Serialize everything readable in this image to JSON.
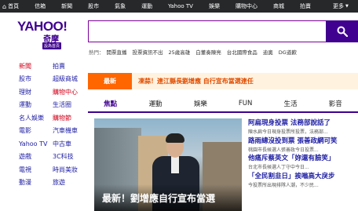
{
  "topnav": {
    "items": [
      "首頁",
      "信箱",
      "新聞",
      "股市",
      "氣象",
      "運動",
      "Yahoo TV",
      "娛樂",
      "購物中心",
      "商城",
      "拍賣",
      "更多"
    ]
  },
  "logo": {
    "brand": "YAHOO!",
    "sub": "奇摩",
    "tag": "設為首頁"
  },
  "search": {
    "placeholder": "",
    "button_icon": "search-icon"
  },
  "trending": {
    "label": "熱門：",
    "items": [
      "開票直播",
      "投票資訊不出",
      "25歲高雄",
      "白董奏陳亮",
      "台北國際食品",
      "迪奧",
      "DG道歉"
    ]
  },
  "sidebar": {
    "rows": [
      [
        "新聞",
        "拍賣"
      ],
      [
        "股市",
        "超級商城"
      ],
      [
        "理財",
        "購物中心"
      ],
      [
        "運動",
        "生活圈"
      ],
      [
        "名人娛樂",
        "購物節"
      ],
      [
        "電影",
        "汽車機車"
      ],
      [
        "Yahoo TV",
        "中古車"
      ],
      [
        "遊戲",
        "3C科技"
      ],
      [
        "電視",
        "時尚美妝"
      ],
      [
        "動漫",
        "旅遊"
      ]
    ]
  },
  "breaking": {
    "label": "最新",
    "text": "凍蒜！連江縣長劉增應 自行宣布當選連任"
  },
  "tabs": [
    "焦點",
    "運動",
    "娛樂",
    "FUN",
    "生活",
    "影音"
  ],
  "hero": {
    "caption": "最新！劉增應自行宣布當選"
  },
  "news": [
    {
      "title": "阿扁現身投票 法務部說話了",
      "desc": "陳水扁今日現身投票所投票，法務部..."
    },
    {
      "title": "路雨總沒投到票 張善政網可笑",
      "desc": "桃園市長候選人張善政今日投票..."
    },
    {
      "title": "他痛斥蔡英文「妳還有臉笑」",
      "desc": "台北市長候選人丁守中今日..."
    },
    {
      "title": "「全民割韭日」挨嗡高大戾步",
      "desc": "今投票所出現排隊人潮，不少民..."
    }
  ],
  "colors": {
    "brand": "#400090",
    "breaking": "#ff6600",
    "link": "#1d1da3"
  }
}
